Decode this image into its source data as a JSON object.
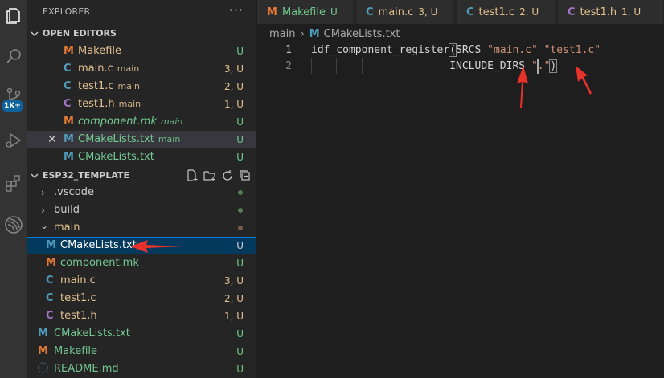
{
  "activity_bar": {
    "badge": "1K+",
    "items": [
      "explorer-icon",
      "search-icon",
      "source-control-icon",
      "run-debug-icon",
      "extensions-icon",
      "espressif-icon"
    ]
  },
  "sidebar": {
    "title": "EXPLORER",
    "more": "···",
    "open_editors": {
      "label": "OPEN EDITORS",
      "items": [
        {
          "icon": "M",
          "name": "Makefile",
          "desc": "",
          "status": "U"
        },
        {
          "icon": "C",
          "name": "main.c",
          "desc": "main",
          "status": "3, U"
        },
        {
          "icon": "C",
          "name": "test1.c",
          "desc": "main",
          "status": "2, U"
        },
        {
          "icon": "C",
          "name": "test1.h",
          "desc": "main",
          "status": "1, U"
        },
        {
          "icon": "M",
          "name": "component.mk",
          "desc": "main",
          "status": "U"
        },
        {
          "icon": "M",
          "name": "CMakeLists.txt",
          "desc": "main",
          "status": "U",
          "close": "✕"
        },
        {
          "icon": "M",
          "name": "CMakeLists.txt",
          "desc": "",
          "status": "U"
        }
      ]
    },
    "workspace": {
      "label": "ESP32_TEMPLATE",
      "items": [
        {
          "name": ".vscode",
          "twistie": "›"
        },
        {
          "name": "build",
          "twistie": "›"
        },
        {
          "name": "main",
          "twistie": "⌄"
        },
        {
          "icon": "M",
          "name": "CMakeLists.txt",
          "status": "U"
        },
        {
          "icon": "M",
          "name": "component.mk",
          "status": "U"
        },
        {
          "icon": "C",
          "name": "main.c",
          "status": "3, U"
        },
        {
          "icon": "C",
          "name": "test1.c",
          "status": "2, U"
        },
        {
          "icon": "C",
          "name": "test1.h",
          "status": "1, U"
        },
        {
          "icon": "M",
          "name": "CMakeLists.txt",
          "status": "U"
        },
        {
          "icon": "M",
          "name": "Makefile",
          "status": "U"
        },
        {
          "icon": "ⓘ",
          "name": "README.md",
          "status": "U"
        }
      ]
    }
  },
  "tabs": [
    {
      "icon": "M",
      "name": "Makefile",
      "status": "U"
    },
    {
      "icon": "C",
      "name": "main.c",
      "status": "3, U"
    },
    {
      "icon": "C",
      "name": "test1.c",
      "status": "2, U"
    },
    {
      "icon": "C",
      "name": "test1.h",
      "status": "1, U"
    }
  ],
  "breadcrumb": {
    "folder": "main",
    "sep": "›",
    "icon": "M",
    "file": "CMakeLists.txt"
  },
  "editor": {
    "line_numbers": [
      "1",
      "2"
    ],
    "line1": {
      "fn": "idf_component_register",
      "open": "(",
      "kw": "SRCS ",
      "s1": "\"main.c\"",
      "space": " ",
      "s2": "\"test1.c\""
    },
    "line2": {
      "indent": "                      ",
      "kw": "INCLUDE_DIRS ",
      "s1": "\".\"",
      "close": ")"
    }
  },
  "colors": {
    "annotation_arrow": "#e8312a",
    "selection_border": "#007fd4",
    "untracked_green": "#73c991",
    "modified_yellow": "#e2c08d"
  }
}
